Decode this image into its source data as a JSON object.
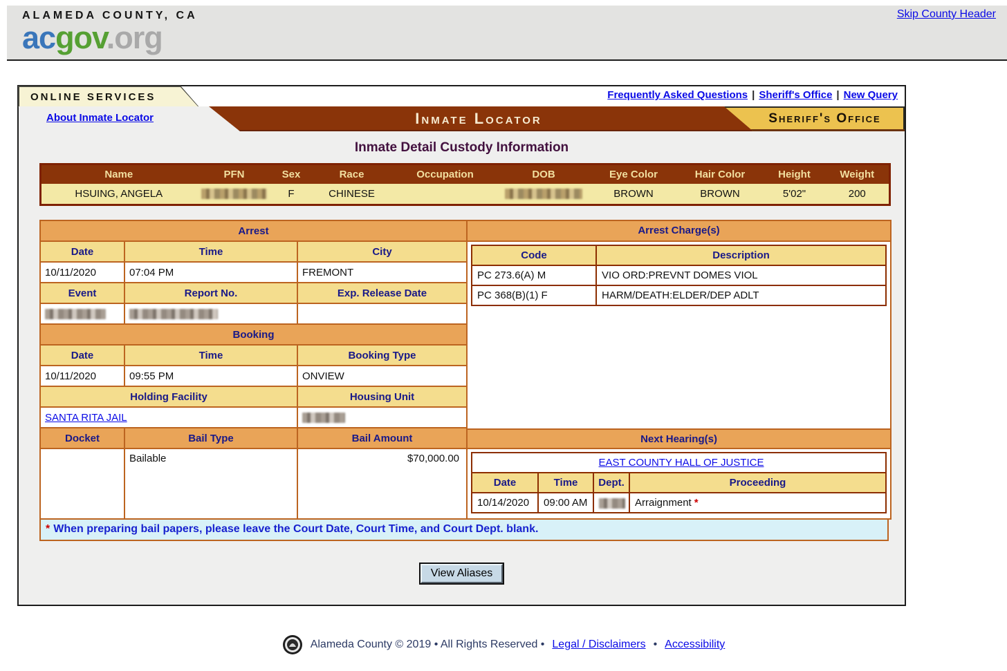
{
  "county_header": {
    "skip_link": "Skip County Header",
    "county_name": "ALAMEDA COUNTY, CA",
    "logo": {
      "part1": "ac",
      "part2": "gov",
      "part3": ".org"
    }
  },
  "nav": {
    "services_tab": "ONLINE SERVICES",
    "links": [
      "Frequently Asked Questions",
      "Sheriff's Office",
      "New Query"
    ],
    "link_separator": "|",
    "about_link": "About Inmate Locator",
    "banner_title": "Inmate Locator",
    "office_tab": "Sheriff's Office"
  },
  "page_title": "Inmate Detail Custody Information",
  "inmate_table": {
    "headers": [
      "Name",
      "PFN",
      "Sex",
      "Race",
      "Occupation",
      "DOB",
      "Eye Color",
      "Hair Color",
      "Height",
      "Weight"
    ],
    "row": {
      "name": "HSUING, ANGELA",
      "sex": "F",
      "race": "CHINESE",
      "occupation": "",
      "eye_color": "BROWN",
      "hair_color": "BROWN",
      "height": "5'02\"",
      "weight": "200"
    }
  },
  "arrest": {
    "title": "Arrest",
    "headers_row1": [
      "Date",
      "Time",
      "City"
    ],
    "values_row1": [
      "10/11/2020",
      "07:04 PM",
      "FREMONT"
    ],
    "headers_row2": [
      "Event",
      "Report No.",
      "Exp. Release Date"
    ]
  },
  "booking": {
    "title": "Booking",
    "headers_row1": [
      "Date",
      "Time",
      "Booking Type"
    ],
    "values_row1": [
      "10/11/2020",
      "09:55 PM",
      "ONVIEW"
    ],
    "headers_row2": [
      "Holding Facility",
      "Housing Unit"
    ],
    "holding_facility_link": "SANTA RITA JAIL"
  },
  "bail": {
    "headers": [
      "Docket",
      "Bail Type",
      "Bail Amount"
    ],
    "bail_type": "Bailable",
    "bail_amount": "$70,000.00"
  },
  "charges": {
    "title": "Arrest Charge(s)",
    "headers": [
      "Code",
      "Description"
    ],
    "rows": [
      {
        "code": "PC 273.6(A) M",
        "description": "VIO ORD:PREVNT DOMES VIOL"
      },
      {
        "code": "PC 368(B)(1) F",
        "description": "HARM/DEATH:ELDER/DEP ADLT"
      }
    ]
  },
  "hearings": {
    "title": "Next Hearing(s)",
    "court_link": "EAST COUNTY HALL OF JUSTICE",
    "headers": [
      "Date",
      "Time",
      "Dept.",
      "Proceeding"
    ],
    "row": {
      "date": "10/14/2020",
      "time": "09:00 AM",
      "proceeding": "Arraignment",
      "asterisk": "*"
    }
  },
  "note": {
    "asterisk": "*",
    "text": "When preparing bail papers, please leave the Court Date, Court Time, and Court Dept. blank."
  },
  "actions": {
    "view_aliases_button": "View Aliases"
  },
  "footer": {
    "copyright": "Alameda County © 2019 • All Rights Reserved •",
    "legal_link": "Legal / Disclaimers",
    "separator": "•",
    "accessibility_link": "Accessibility"
  },
  "colors": {
    "banner_brown": "#8a3409",
    "banner_gold": "#ecc24f",
    "section_header_orange": "#e9a458",
    "column_header_yellow": "#f4dd8e",
    "inmate_row_yellow": "#f3e9a6",
    "table_border_orange": "#bc6420",
    "inner_border_maroon": "#8c2e00",
    "note_bg_blue": "#d8f1f8",
    "link_blue": "#0a0ae6",
    "header_navy": "#191988",
    "title_purple": "#43113f"
  }
}
